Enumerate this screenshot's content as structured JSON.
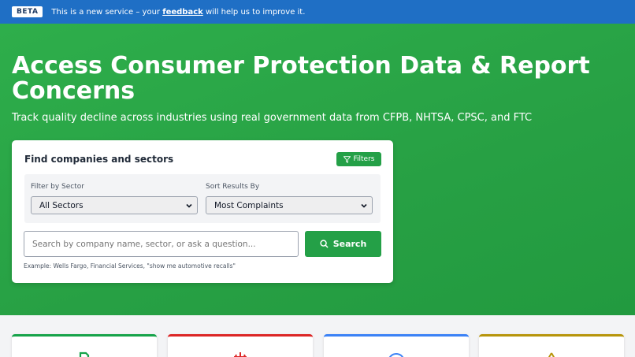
{
  "beta_banner": {
    "tag": "BETA",
    "text_before": "This is a new service – your",
    "link_text": "feedback",
    "text_after": "will help us to improve it."
  },
  "hero": {
    "title": "Access Consumer Protection Data & Report Concerns",
    "subtitle": "Track quality decline across industries using real government data from CFPB, NHTSA, CPSC, and FTC"
  },
  "search_card": {
    "title": "Find companies and sectors",
    "filters_button": "Filters",
    "sector_filter": {
      "label": "Filter by Sector",
      "selected": "All Sectors"
    },
    "sort_filter": {
      "label": "Sort Results By",
      "selected": "Most Complaints"
    },
    "search_placeholder": "Search by company name, sector, or ask a question...",
    "search_button": "Search",
    "example_text": "Example: Wells Fargo, Financial Services, \"show me automotive recalls\""
  },
  "feature_tiles": [
    {
      "icon": "document-icon",
      "accent": "#16a34a"
    },
    {
      "icon": "scales-icon",
      "accent": "#dc2626"
    },
    {
      "icon": "globe-icon",
      "accent": "#3b82f6"
    },
    {
      "icon": "warning-icon",
      "accent": "#b7950b"
    }
  ],
  "colors": {
    "beta_bar": "#1f6fc5",
    "hero_green": "#27a044",
    "button_green": "#24a047"
  }
}
